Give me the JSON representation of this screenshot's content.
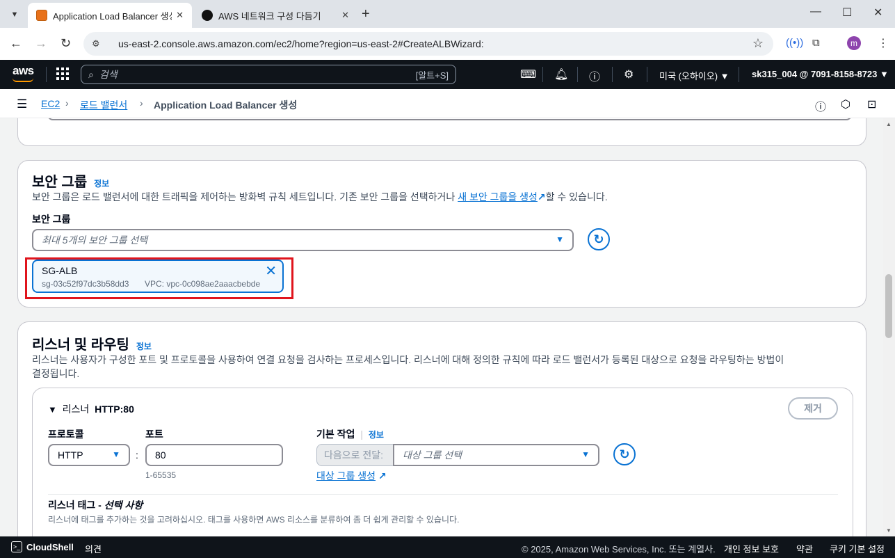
{
  "browser": {
    "tabs": [
      {
        "title": "Application Load Balancer 생성 | E",
        "icon": "aws-favicon"
      },
      {
        "title": "AWS 네트워크 구성 다듬기",
        "icon": "chatgpt-favicon"
      }
    ],
    "new_tab": "+",
    "url": "us-east-2.console.aws.amazon.com/ec2/home?region=us-east-2#CreateALBWizard:",
    "profile_initial": "m"
  },
  "aws_header": {
    "logo": "aws",
    "search_placeholder": "검색",
    "search_shortcut": "[알트+S]",
    "region": "미국 (오하이오) ▼",
    "account": "sk315_004 @ 7091-8158-8723 ▼"
  },
  "breadcrumb": {
    "items": [
      "EC2",
      "로드 밸런서",
      "Application Load Balancer 생성"
    ],
    "separator": "›"
  },
  "security_group": {
    "title": "보안 그룹",
    "info": "정보",
    "desc_before": "보안 그룹은 로드 밸런서에 대한 트래픽을 제어하는 방화벽 규칙 세트입니다. 기존 보안 그룹을 선택하거나 ",
    "desc_link": "새 보안 그룹을 생성",
    "desc_after": "할 수 있습니다.",
    "field_label": "보안 그룹",
    "select_placeholder": "최대 5개의 보안 그룹 선택",
    "selected": {
      "name": "SG-ALB",
      "id": "sg-03c52f97dc3b58dd3",
      "vpc": "VPC: vpc-0c098ae2aaacbebde"
    }
  },
  "listeners": {
    "title": "리스너 및 라우팅",
    "info": "정보",
    "desc": "리스너는 사용자가 구성한 포트 및 프로토콜을 사용하여 연결 요청을 검사하는 프로세스입니다. 리스너에 대해 정의한 규칙에 따라 로드 밸런서가 등록된 대상으로 요청을 라우팅하는 방법이",
    "desc_line2": "결정됩니다.",
    "listener": {
      "prefix": "리스너",
      "name": "HTTP:80",
      "remove": "제거",
      "protocol_label": "프로토콜",
      "protocol_value": "HTTP",
      "port_label": "포트",
      "port_value": "80",
      "port_hint": "1-65535",
      "colon": ":",
      "action_label": "기본 작업",
      "action_info": "정보",
      "forward_label": "다음으로 전달:",
      "target_placeholder": "대상 그룹 선택",
      "create_target_link": "대상 그룹 생성",
      "tags_title": "리스너 태그 - ",
      "tags_optional": "선택 사항",
      "tags_desc": "리스너에 태그를 추가하는 것을 고려하십시오. 태그를 사용하면 AWS 리소스를 분류하여 좀 더 쉽게 관리할 수 있습니다."
    }
  },
  "footer": {
    "cloudshell": "CloudShell",
    "feedback": "의견",
    "copyright": "© 2025, Amazon Web Services, Inc. 또는 계열사.",
    "privacy": "개인 정보 보호",
    "terms": "약관",
    "cookies": "쿠키 기본 설정"
  },
  "colors": {
    "link": "#0972d3",
    "aws_header": "#0f141a",
    "highlight": "#e0141c",
    "token_bg": "#f2f8fd"
  }
}
